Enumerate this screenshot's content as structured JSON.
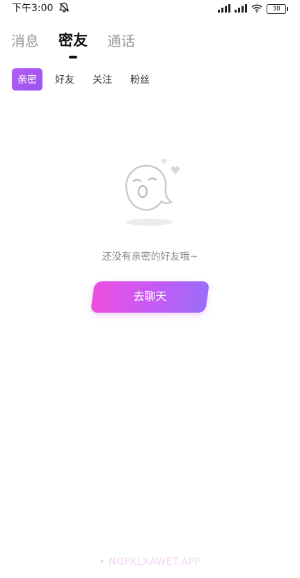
{
  "status_bar": {
    "time": "下午3:00",
    "battery": "38"
  },
  "main_tabs": [
    {
      "label": "消息",
      "active": false
    },
    {
      "label": "密友",
      "active": true
    },
    {
      "label": "通话",
      "active": false
    }
  ],
  "sub_tabs": [
    {
      "label": "亲密",
      "active": true
    },
    {
      "label": "好友",
      "active": false
    },
    {
      "label": "关注",
      "active": false
    },
    {
      "label": "粉丝",
      "active": false
    }
  ],
  "empty_state": {
    "message": "还没有亲密的好友哦~",
    "button_label": "去聊天"
  },
  "watermark": "• NOFKLXAWET.APP",
  "colors": {
    "accent_start": "#ef4fe0",
    "accent_end": "#9b6cf8",
    "sub_tab_active": "#b45cf5"
  }
}
